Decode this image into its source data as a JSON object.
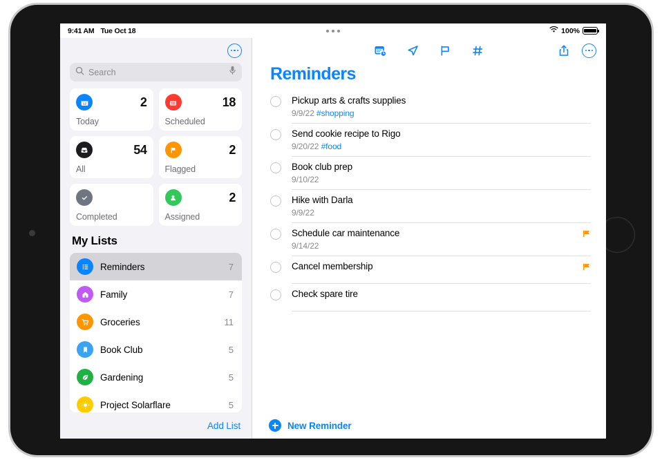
{
  "status_bar": {
    "time": "9:41 AM",
    "date": "Tue Oct 18",
    "battery_percent": "100%",
    "wifi_icon": "wifi-icon",
    "battery_icon": "battery-full-icon",
    "multitask_handle": "multitasking-dots"
  },
  "sidebar": {
    "more_button_icon": "ellipsis-circle-icon",
    "search": {
      "placeholder": "Search",
      "value": "",
      "search_icon": "search-icon",
      "mic_icon": "microphone-icon"
    },
    "smart_lists": [
      {
        "label": "Today",
        "count": "2",
        "icon": "calendar-day-icon",
        "color": "#0a84ff"
      },
      {
        "label": "Scheduled",
        "count": "18",
        "icon": "calendar-icon",
        "color": "#ff3b30"
      },
      {
        "label": "All",
        "count": "54",
        "icon": "inbox-tray-icon",
        "color": "#1c1c1e"
      },
      {
        "label": "Flagged",
        "count": "2",
        "icon": "flag-icon",
        "color": "#ff9500"
      },
      {
        "label": "Completed",
        "count": "",
        "icon": "checkmark-icon",
        "color": "#6e7781"
      },
      {
        "label": "Assigned",
        "count": "2",
        "icon": "person-icon",
        "color": "#34c759"
      }
    ],
    "my_lists_title": "My Lists",
    "lists": [
      {
        "name": "Reminders",
        "count": "7",
        "icon": "list-bullet-icon",
        "color": "#0a84ff",
        "selected": true
      },
      {
        "name": "Family",
        "count": "7",
        "icon": "house-icon",
        "color": "#bf5af2",
        "selected": false
      },
      {
        "name": "Groceries",
        "count": "11",
        "icon": "cart-icon",
        "color": "#ff9500",
        "selected": false
      },
      {
        "name": "Book Club",
        "count": "5",
        "icon": "bookmark-icon",
        "color": "#3ba4f0",
        "selected": false
      },
      {
        "name": "Gardening",
        "count": "5",
        "icon": "leaf-icon",
        "color": "#1fb141",
        "selected": false
      },
      {
        "name": "Project Solarflare",
        "count": "5",
        "icon": "sun-icon",
        "color": "#ffcc00",
        "selected": false
      }
    ],
    "add_list_label": "Add List"
  },
  "main": {
    "toolbar_center_icons": [
      "calendar-clock-icon",
      "location-arrow-icon",
      "flag-outline-icon",
      "hashtag-icon"
    ],
    "toolbar_right_icons": [
      "share-icon",
      "ellipsis-circle-icon"
    ],
    "title": "Reminders",
    "reminders": [
      {
        "title": "Pickup arts & crafts supplies",
        "date": "9/9/22",
        "tag": "#shopping",
        "flagged": false
      },
      {
        "title": "Send cookie recipe to Rigo",
        "date": "9/20/22",
        "tag": "#food",
        "flagged": false
      },
      {
        "title": "Book club prep",
        "date": "9/10/22",
        "tag": "",
        "flagged": false
      },
      {
        "title": "Hike with Darla",
        "date": "9/9/22",
        "tag": "",
        "flagged": false
      },
      {
        "title": "Schedule car maintenance",
        "date": "9/14/22",
        "tag": "",
        "flagged": true
      },
      {
        "title": "Cancel membership",
        "date": "",
        "tag": "",
        "flagged": true
      },
      {
        "title": "Check spare tire",
        "date": "",
        "tag": "",
        "flagged": false
      }
    ],
    "new_reminder_label": "New Reminder",
    "new_reminder_icon": "plus-circle-icon"
  },
  "colors": {
    "accent": "#0a84ff",
    "flag": "#ff9500",
    "sidebar_bg": "#f2f2f7",
    "selected_row": "#d3d3d8"
  }
}
